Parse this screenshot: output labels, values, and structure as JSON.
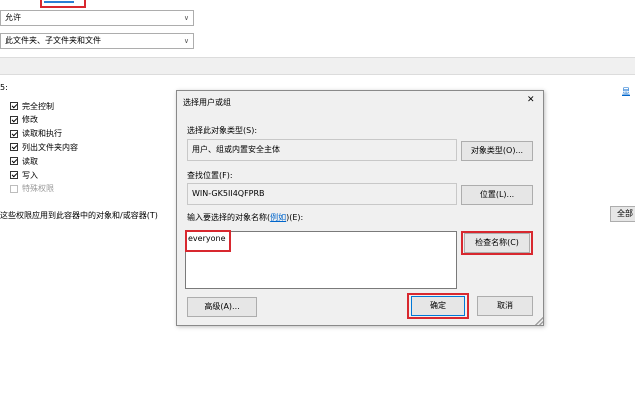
{
  "left_panel": {
    "type_combo": "允许",
    "applies_combo": "此文件夹、子文件夹和文件",
    "permissions_label": "5:",
    "permissions": [
      {
        "label": "完全控制",
        "checked": true,
        "disabled": false
      },
      {
        "label": "修改",
        "checked": true,
        "disabled": false
      },
      {
        "label": "读取和执行",
        "checked": true,
        "disabled": false
      },
      {
        "label": "列出文件夹内容",
        "checked": true,
        "disabled": false
      },
      {
        "label": "读取",
        "checked": true,
        "disabled": false
      },
      {
        "label": "写入",
        "checked": true,
        "disabled": false
      },
      {
        "label": "特殊权限",
        "checked": false,
        "disabled": true
      }
    ],
    "apply_note": "这些权限应用到此容器中的对象和/或容器(T)"
  },
  "right_edge": {
    "link_fragment": "显",
    "button_fragment": "全部"
  },
  "dialog": {
    "title": "选择用户或组",
    "close_glyph": "✕",
    "object_type_label": "选择此对象类型(S):",
    "object_type_value": "用户、组或内置安全主体",
    "object_type_button": "对象类型(O)...",
    "location_label": "查找位置(F):",
    "location_value": "WIN-GK5II4QFPRB",
    "location_button": "位置(L)...",
    "names_label_prefix": "输入要选择的对象名称(",
    "names_label_link": "例如",
    "names_label_suffix": ")(E):",
    "names_value": "everyone",
    "check_names_button": "检查名称(C)",
    "advanced_button": "高级(A)...",
    "ok_button": "确定",
    "cancel_button": "取消"
  },
  "colors": {
    "highlight": "#d8282f",
    "dialog_bg": "#f0f0f0",
    "link": "#0066cc"
  }
}
